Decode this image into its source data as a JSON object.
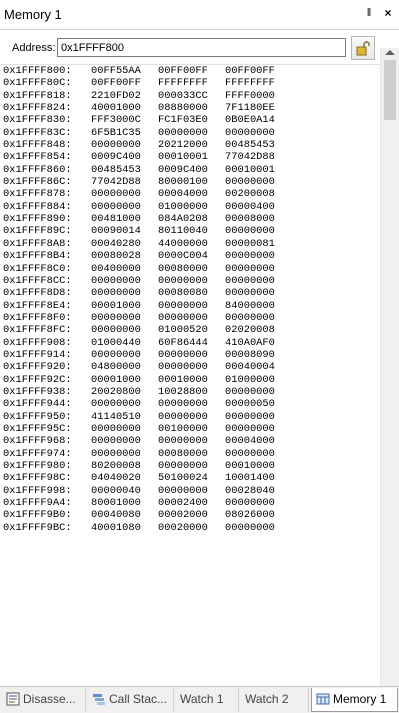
{
  "window": {
    "title": "Memory 1",
    "pin_glyph": "‖",
    "close_glyph": "×"
  },
  "address_bar": {
    "label": "Address:",
    "value": "0x1FFFF800"
  },
  "memory_rows": [
    {
      "addr": "0x1FFFF800:",
      "w1": "00FF55AA",
      "w2": "00FF00FF",
      "w3": "00FF00FF"
    },
    {
      "addr": "0x1FFFF80C:",
      "w1": "00FF00FF",
      "w2": "FFFFFFFF",
      "w3": "FFFFFFFF"
    },
    {
      "addr": "0x1FFFF818:",
      "w1": "2210FD02",
      "w2": "000033CC",
      "w3": "FFFF0000"
    },
    {
      "addr": "0x1FFFF824:",
      "w1": "40001000",
      "w2": "08880000",
      "w3": "7F1180EE"
    },
    {
      "addr": "0x1FFFF830:",
      "w1": "FFF3000C",
      "w2": "FC1F03E0",
      "w3": "0B0E0A14"
    },
    {
      "addr": "0x1FFFF83C:",
      "w1": "6F5B1C35",
      "w2": "00000000",
      "w3": "00000000"
    },
    {
      "addr": "0x1FFFF848:",
      "w1": "00000000",
      "w2": "20212000",
      "w3": "00485453"
    },
    {
      "addr": "0x1FFFF854:",
      "w1": "0009C400",
      "w2": "00010001",
      "w3": "77042D88"
    },
    {
      "addr": "0x1FFFF860:",
      "w1": "00485453",
      "w2": "0009C400",
      "w3": "00010001"
    },
    {
      "addr": "0x1FFFF86C:",
      "w1": "77042D88",
      "w2": "80000100",
      "w3": "00000000"
    },
    {
      "addr": "0x1FFFF878:",
      "w1": "00000000",
      "w2": "00004000",
      "w3": "00200008"
    },
    {
      "addr": "0x1FFFF884:",
      "w1": "00000000",
      "w2": "01000000",
      "w3": "00000400"
    },
    {
      "addr": "0x1FFFF890:",
      "w1": "00481000",
      "w2": "084A0208",
      "w3": "00008000"
    },
    {
      "addr": "0x1FFFF89C:",
      "w1": "00090014",
      "w2": "80110040",
      "w3": "00000000"
    },
    {
      "addr": "0x1FFFF8A8:",
      "w1": "00040280",
      "w2": "44000000",
      "w3": "00000081"
    },
    {
      "addr": "0x1FFFF8B4:",
      "w1": "00080028",
      "w2": "0000C004",
      "w3": "00000000"
    },
    {
      "addr": "0x1FFFF8C0:",
      "w1": "00400000",
      "w2": "00080000",
      "w3": "00000000"
    },
    {
      "addr": "0x1FFFF8CC:",
      "w1": "00000000",
      "w2": "00000000",
      "w3": "00000000"
    },
    {
      "addr": "0x1FFFF8D8:",
      "w1": "00000000",
      "w2": "00080080",
      "w3": "00000000"
    },
    {
      "addr": "0x1FFFF8E4:",
      "w1": "00001000",
      "w2": "00000000",
      "w3": "84000000"
    },
    {
      "addr": "0x1FFFF8F0:",
      "w1": "00000000",
      "w2": "00000000",
      "w3": "00000000"
    },
    {
      "addr": "0x1FFFF8FC:",
      "w1": "00000000",
      "w2": "01000520",
      "w3": "02020008"
    },
    {
      "addr": "0x1FFFF908:",
      "w1": "01000440",
      "w2": "60F86444",
      "w3": "410A0AF0"
    },
    {
      "addr": "0x1FFFF914:",
      "w1": "00000000",
      "w2": "00000000",
      "w3": "00008090"
    },
    {
      "addr": "0x1FFFF920:",
      "w1": "04800000",
      "w2": "00000000",
      "w3": "00040004"
    },
    {
      "addr": "0x1FFFF92C:",
      "w1": "00001000",
      "w2": "00010000",
      "w3": "01000000"
    },
    {
      "addr": "0x1FFFF938:",
      "w1": "20020800",
      "w2": "10028800",
      "w3": "00000000"
    },
    {
      "addr": "0x1FFFF944:",
      "w1": "00000000",
      "w2": "00000000",
      "w3": "00000050"
    },
    {
      "addr": "0x1FFFF950:",
      "w1": "41140510",
      "w2": "00000000",
      "w3": "00000000"
    },
    {
      "addr": "0x1FFFF95C:",
      "w1": "00000000",
      "w2": "00100000",
      "w3": "00000000"
    },
    {
      "addr": "0x1FFFF968:",
      "w1": "00000000",
      "w2": "00000000",
      "w3": "00004000"
    },
    {
      "addr": "0x1FFFF974:",
      "w1": "00000000",
      "w2": "00080000",
      "w3": "00000000"
    },
    {
      "addr": "0x1FFFF980:",
      "w1": "80200008",
      "w2": "00000000",
      "w3": "00010000"
    },
    {
      "addr": "0x1FFFF98C:",
      "w1": "04040020",
      "w2": "50100024",
      "w3": "10001400"
    },
    {
      "addr": "0x1FFFF998:",
      "w1": "00000040",
      "w2": "00000000",
      "w3": "00028040"
    },
    {
      "addr": "0x1FFFF9A4:",
      "w1": "80001000",
      "w2": "00002400",
      "w3": "00000000"
    },
    {
      "addr": "0x1FFFF9B0:",
      "w1": "00040080",
      "w2": "00002000",
      "w3": "08026000"
    },
    {
      "addr": "0x1FFFF9BC:",
      "w1": "40001080",
      "w2": "00020000",
      "w3": "00000000"
    }
  ],
  "tabs": [
    {
      "label": "Disasse...",
      "icon": "disassembly-icon",
      "active": false
    },
    {
      "label": "Call Stac...",
      "icon": "call-stack-icon",
      "active": false
    },
    {
      "label": "Watch 1",
      "icon": "",
      "active": false
    },
    {
      "label": "Watch 2",
      "icon": "",
      "active": false
    },
    {
      "label": "Memory 1",
      "icon": "memory-icon",
      "active": true
    }
  ],
  "colors": {
    "title_bg": "#ffffff",
    "tab_bar_bg": "#f0f0f0",
    "active_tab_bg": "#ffffff",
    "border": "#9a9a9a"
  }
}
